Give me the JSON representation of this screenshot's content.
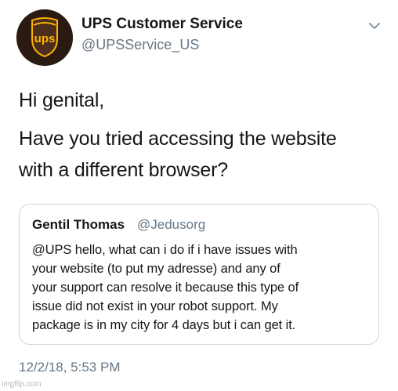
{
  "tweet": {
    "author": {
      "display_name": "UPS Customer Service",
      "handle": "@UPSService_US",
      "avatar_logo_text": "ups",
      "avatar_colors": {
        "background": "#2b1a11",
        "shield": "#4b2e1b",
        "logo_gold": "#ffb500"
      }
    },
    "menu_icon": "chevron-down-icon",
    "body_lines": [
      "Hi genital,",
      "Have you tried accessing the website",
      "with a different browser?"
    ],
    "quoted_tweet": {
      "display_name": "Gentil Thomas",
      "handle": "@Jedusorg",
      "text_lines": [
        "@UPS hello, what can i do if i have issues with",
        "your website (to put my adresse) and any of",
        "your support can resolve it because this type of",
        "issue did not exist in your robot support. My",
        "package is in my city for 4 days but i can get it."
      ]
    },
    "timestamp": "12/2/18, 5:53 PM"
  },
  "watermark": "imgflip.com",
  "colors": {
    "text": "#14171a",
    "secondary_text": "#657786",
    "border": "#ccd6dd"
  }
}
